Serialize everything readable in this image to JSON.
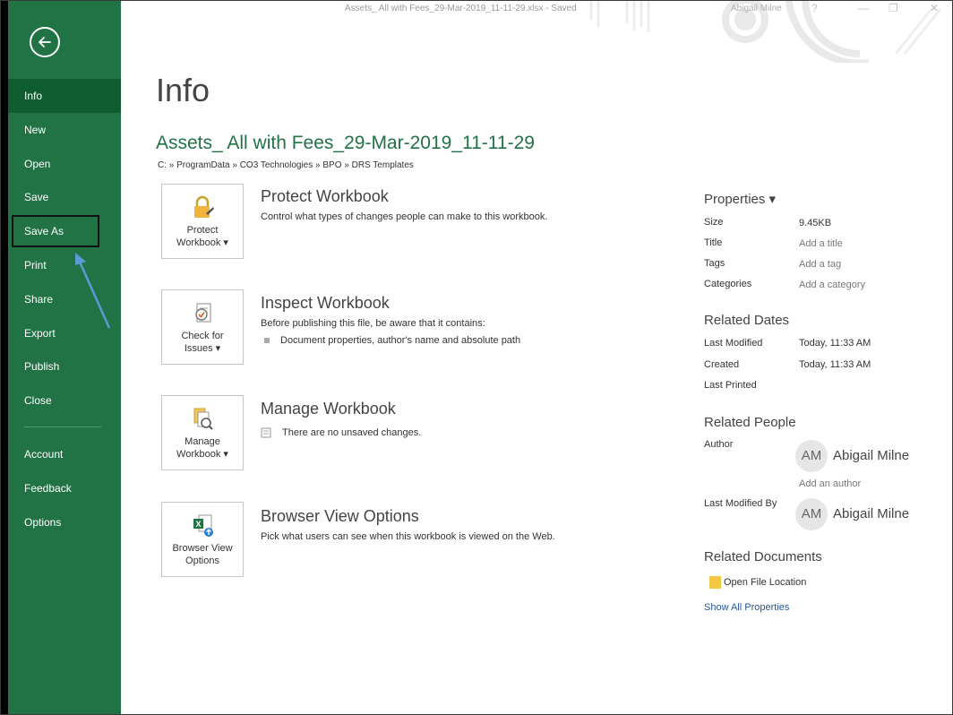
{
  "titlebar": {
    "document_status": "Assets_ All with Fees_29-Mar-2019_11-11-29.xlsx - Saved",
    "user": "Abigail Milne",
    "help_glyph": "?",
    "minimize_glyph": "—",
    "restore_glyph": "❐",
    "close_glyph": "✕"
  },
  "sidebar": {
    "back_icon": "back-arrow-icon",
    "items": [
      {
        "label": "Info"
      },
      {
        "label": "New"
      },
      {
        "label": "Open"
      },
      {
        "label": "Save"
      },
      {
        "label": "Save As"
      },
      {
        "label": "Print"
      },
      {
        "label": "Share"
      },
      {
        "label": "Export"
      },
      {
        "label": "Publish"
      },
      {
        "label": "Close"
      },
      {
        "label": "Account"
      },
      {
        "label": "Feedback"
      },
      {
        "label": "Options"
      }
    ],
    "active_item": "Info",
    "highlighted_item": "Save As"
  },
  "main": {
    "page_title": "Info",
    "doc_title": "Assets_ All with Fees_29-Mar-2019_11-11-29",
    "doc_path": "C: » ProgramData » CO3 Technologies » BPO » DRS Templates",
    "sections": [
      {
        "tile_label_1": "Protect",
        "tile_label_2": "Workbook ▾",
        "heading": "Protect Workbook",
        "description": "Control what types of changes people can make to this workbook."
      },
      {
        "tile_label_1": "Check for",
        "tile_label_2": "Issues ▾",
        "heading": "Inspect Workbook",
        "description": "Before publishing this file, be aware that it contains:",
        "bullet": "Document properties, author's name and absolute path"
      },
      {
        "tile_label_1": "Manage",
        "tile_label_2": "Workbook ▾",
        "heading": "Manage Workbook",
        "description": "There are no unsaved changes."
      },
      {
        "tile_label_1": "Browser View",
        "tile_label_2": "Options",
        "heading": "Browser View Options",
        "description": "Pick what users can see when this workbook is viewed on the Web."
      }
    ]
  },
  "properties": {
    "heading": "Properties ▾",
    "size_label": "Size",
    "size_value": "9.45KB",
    "title_label": "Title",
    "title_value": "Add a title",
    "tags_label": "Tags",
    "tags_value": "Add a tag",
    "categories_label": "Categories",
    "categories_value": "Add a category",
    "related_dates_heading": "Related Dates",
    "last_modified_label": "Last Modified",
    "last_modified_value": "Today, 11:33 AM",
    "created_label": "Created",
    "created_value": "Today, 11:33 AM",
    "last_printed_label": "Last Printed",
    "related_people_heading": "Related People",
    "author_label": "Author",
    "author_initials": "AM",
    "author_name": "Abigail Milne",
    "add_author": "Add an author",
    "last_modified_by_label": "Last Modified By",
    "modifier_initials": "AM",
    "modifier_name": "Abigail Milne",
    "related_documents_heading": "Related Documents",
    "open_file_location": "Open File Location",
    "show_all_properties": "Show All Properties"
  },
  "colors": {
    "sidebar": "#217346",
    "sidebar_active": "#0e5c30",
    "title_green": "#217346",
    "link_blue": "#2b579a",
    "annotation_arrow": "#5b9bd5"
  }
}
